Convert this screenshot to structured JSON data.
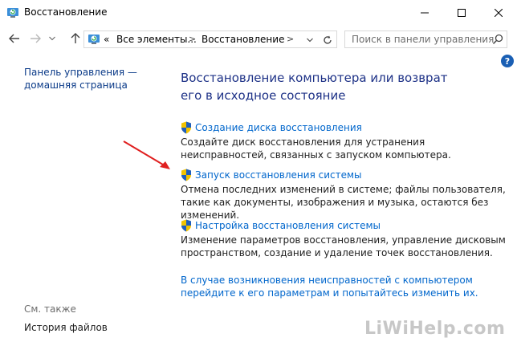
{
  "window": {
    "title": "Восстановление"
  },
  "nav": {
    "breadcrumb_prefix": "«",
    "breadcrumbs": [
      "Все элементы...",
      "Восстановление"
    ],
    "search_placeholder": "Поиск в панели управления"
  },
  "help_label": "?",
  "left": {
    "home_link": "Панель управления — домашняя страница",
    "see_also": "См. также",
    "file_history": "История файлов"
  },
  "main": {
    "heading": "Восстановление компьютера или возврат его в исходное состояние",
    "tasks": [
      {
        "title": "Создание диска восстановления",
        "desc": "Создайте диск восстановления для устранения неисправностей, связанных с запуском компьютера."
      },
      {
        "title": "Запуск восстановления системы",
        "desc": "Отмена последних изменений в системе; файлы пользователя, такие как документы, изображения и музыка, остаются без изменений."
      },
      {
        "title": "Настройка восстановления системы",
        "desc": "Изменение параметров восстановления, управление дисковым пространством, создание и удаление точек восстановления."
      }
    ],
    "bottom_link": "В случае возникновения неисправностей с компьютером перейдите к его параметрам и попытайтесь изменить их."
  },
  "watermark": "LiWiHelp.com",
  "colors": {
    "link": "#0066cc",
    "heading": "#1e3287",
    "arrow": "#e02020"
  }
}
